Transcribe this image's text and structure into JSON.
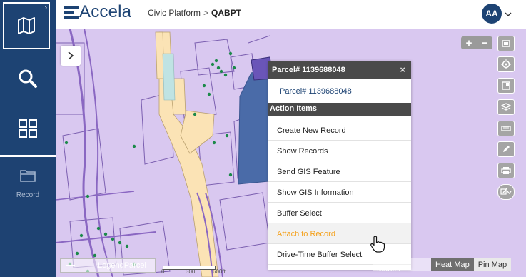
{
  "app": {
    "logo_text": "Accela",
    "breadcrumb_parent": "Civic Platform",
    "breadcrumb_separator": ">",
    "breadcrumb_current": "QABPT",
    "user_initials": "AA"
  },
  "sidebar": {
    "items": [
      {
        "name": "map",
        "icon": "map-icon"
      },
      {
        "name": "search",
        "icon": "search-icon"
      },
      {
        "name": "apps",
        "icon": "grid-icon"
      },
      {
        "name": "record",
        "icon": "folder-icon",
        "label": "Record"
      }
    ]
  },
  "map": {
    "controls": {
      "zoom_in": "+",
      "zoom_out": "−"
    },
    "scale_labels": [
      "0",
      "300",
      "600ft"
    ],
    "legend_label": "Legend",
    "legend_layer": "Parcel",
    "view_tabs": [
      "Cluster Marker",
      "Heat Map",
      "Pin Map"
    ]
  },
  "popup": {
    "title": "Parcel# 1139688048",
    "close": "×",
    "parcel_link": "Parcel# 1139688048",
    "section_title": "Action Items",
    "actions": [
      "Create New Record",
      "Show Records",
      "Send GIS Feature",
      "Show GIS Information",
      "Buffer Select",
      "Attach to Record",
      "Drive-Time Buffer Select"
    ],
    "hover_index": 5
  },
  "colors": {
    "sidebar": "#1d4373",
    "map_bg": "#d9c8f0",
    "road": "#fbe3b5",
    "selected_parcel": "#4a6ba8",
    "accent_hover": "#f4a21e",
    "point": "#1c8a4a"
  }
}
